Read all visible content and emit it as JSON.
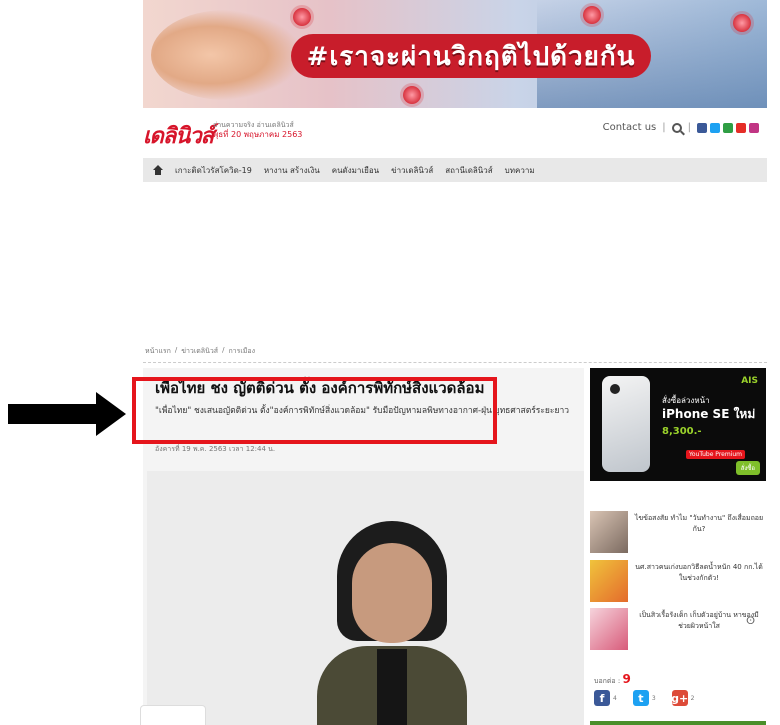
{
  "banner": {
    "headline": "#เราจะผ่านวิกฤติไปด้วยกัน"
  },
  "header": {
    "logo": "เดลินิวส์",
    "logo_sub": "อ่านความจริง อ่านเดลินิวส์",
    "date": "พุธที่ 20 พฤษภาคม 2563",
    "contact": "Contact us"
  },
  "nav": {
    "items": [
      "เกาะติดไวรัสโควิด-19",
      "หางาน สร้างเงิน",
      "คนดังมาเยือน",
      "ข่าวเดลินิวส์",
      "สถานีเดลินิวส์",
      "บทความ"
    ]
  },
  "breadcrumb": [
    "หน้าแรก",
    "/",
    "ข่าวเดลินิวส์",
    "/",
    "การเมือง"
  ],
  "article": {
    "title": "เพื่อไทย  ชง ญัตติด่วน ตั้ง องค์การพิทักษ์สิ่งแวดล้อม",
    "desc": "\"เพื่อไทย\" ชงเสนอญัตติด่วน ตั้ง\"องค์การพิทักษ์สิ่งแวดล้อม\" รับมือปัญหามลพิษทางอากาศ-ฝุ่น ยุทธศาสตร์ระยะยาว",
    "date": "อังคารที่ 19 พ.ค. 2563 เวลา 12:44 น."
  },
  "sidebar": {
    "ad": {
      "brand": "AIS",
      "line1": "สั่งซื้อล่วงหน้า",
      "line2": "iPhone SE ใหม่",
      "price": "8,300.-",
      "badge": "YouTube Premium",
      "button": "สั่งซื้อ"
    },
    "news": [
      "ไขข้อสงสัย ทำไม \"วันทำงาน\" ถึงเสื่อมถอยกัน?",
      "นศ.สาวคนเก่งบอกวิธีลดน้ำหนัก 40 กก.ได้ในช่วงกักตัว!",
      "เป็นสิวเรื้อรังเด็ก เก็บตัวอยู่บ้าน หาของมีช่วยผิวหน้าใส"
    ],
    "pin": "ⵙ",
    "share_label": "บอกต่อ :",
    "share_count": "9",
    "facebook_count": "4",
    "twitter_count": "3",
    "gplus_count": "2"
  }
}
